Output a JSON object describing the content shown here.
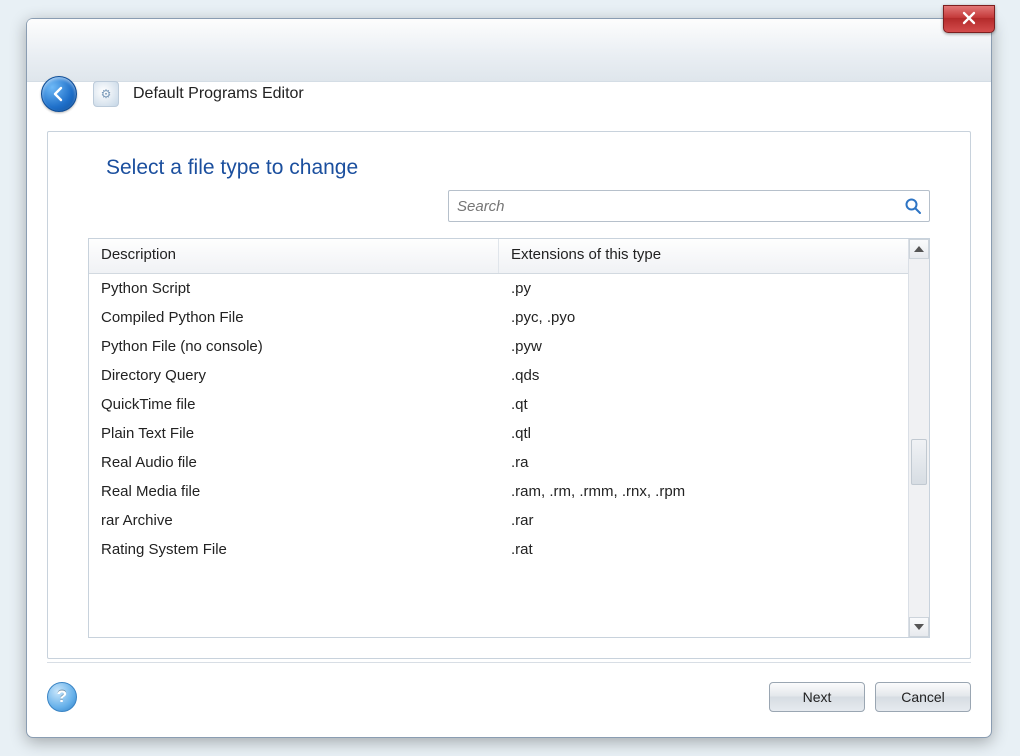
{
  "window": {
    "title": "Default Programs Editor"
  },
  "page": {
    "heading": "Select a file type to change"
  },
  "search": {
    "placeholder": "Search"
  },
  "columns": {
    "description": "Description",
    "extensions": "Extensions of this type"
  },
  "rows": [
    {
      "description": "Python Script",
      "extensions": ".py"
    },
    {
      "description": "Compiled Python File",
      "extensions": ".pyc, .pyo"
    },
    {
      "description": "Python File (no console)",
      "extensions": ".pyw"
    },
    {
      "description": "Directory Query",
      "extensions": ".qds"
    },
    {
      "description": "QuickTime file",
      "extensions": ".qt"
    },
    {
      "description": "Plain Text File",
      "extensions": ".qtl"
    },
    {
      "description": "Real Audio file",
      "extensions": ".ra"
    },
    {
      "description": "Real Media file",
      "extensions": ".ram, .rm, .rmm, .rnx, .rpm"
    },
    {
      "description": "rar Archive",
      "extensions": ".rar"
    },
    {
      "description": "Rating System File",
      "extensions": ".rat"
    }
  ],
  "buttons": {
    "next": "Next",
    "cancel": "Cancel"
  }
}
